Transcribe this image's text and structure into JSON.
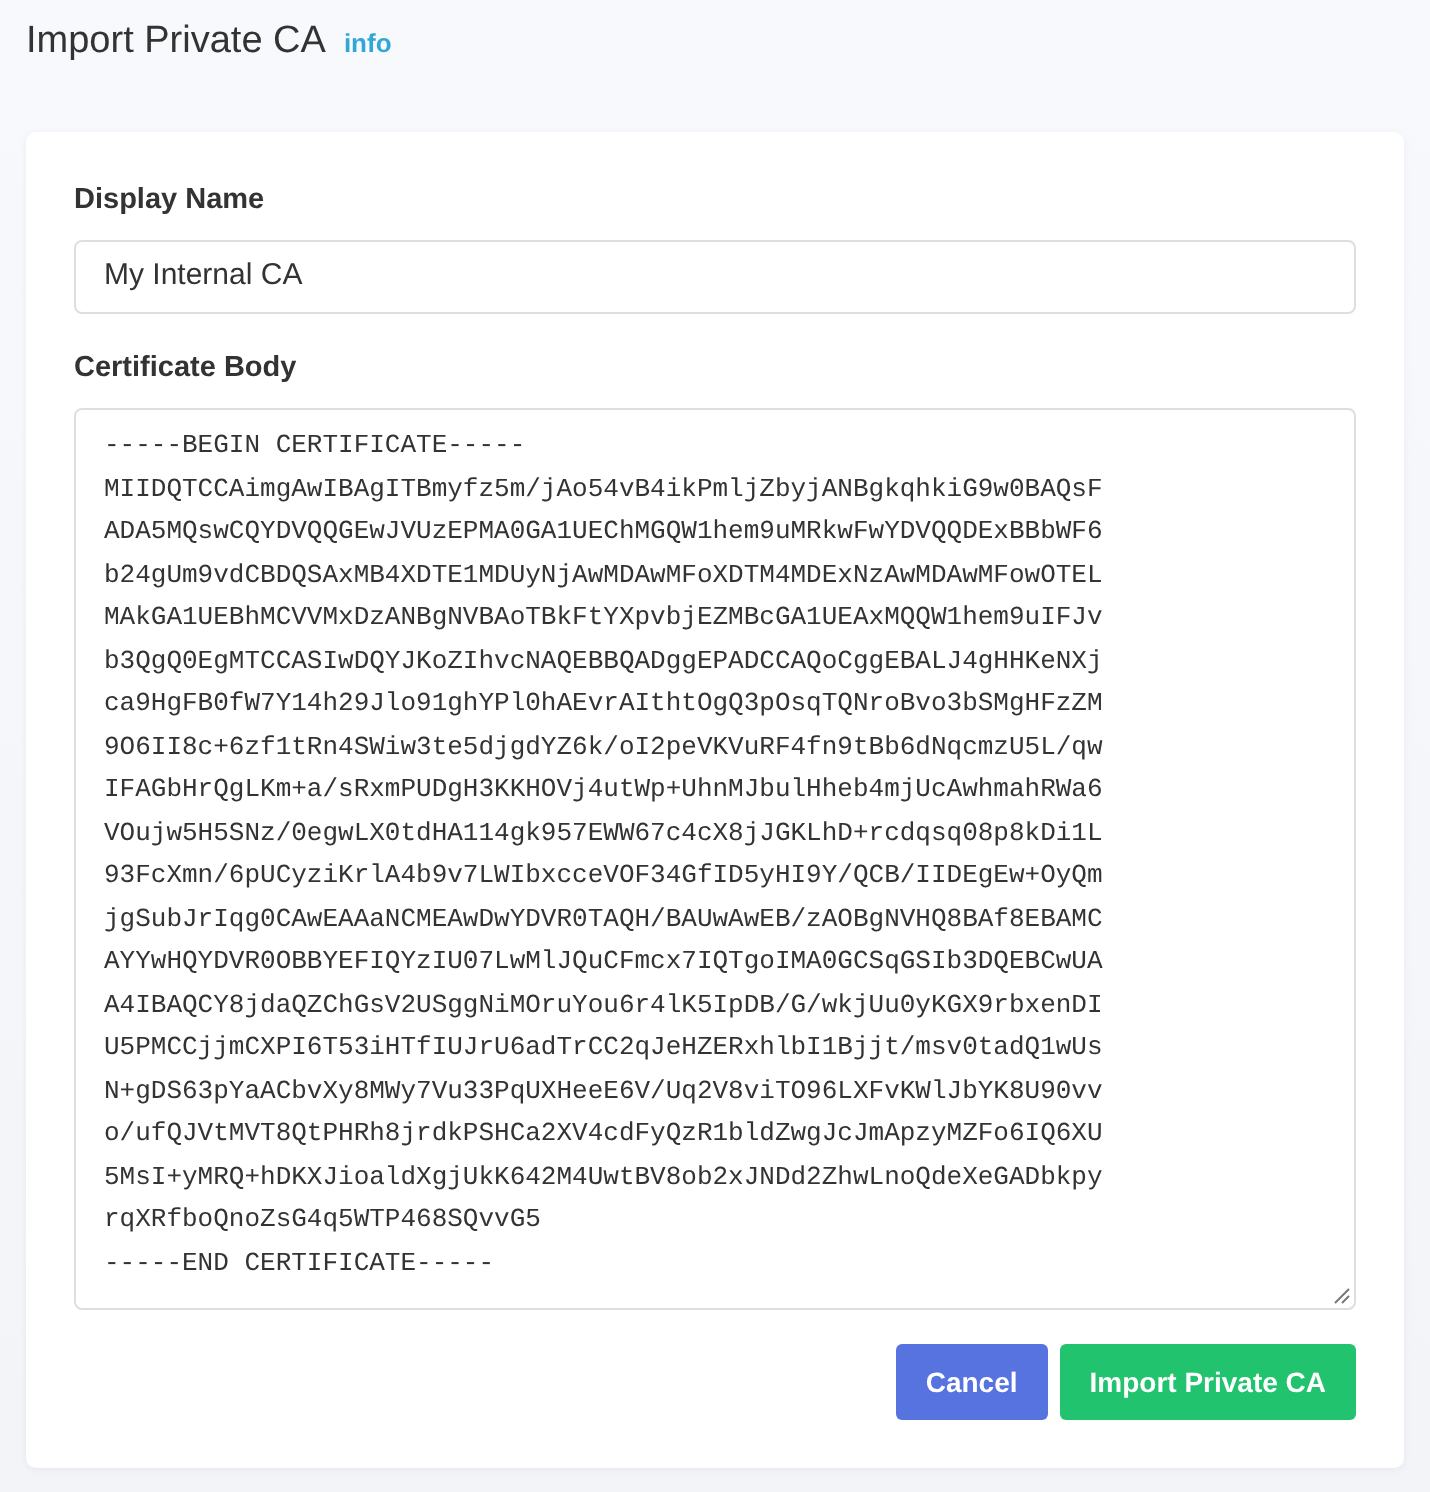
{
  "page": {
    "title": "Import Private CA",
    "info_link": "info"
  },
  "form": {
    "fields": [
      {
        "kind": "input",
        "label": "Display Name",
        "value": "My Internal CA"
      },
      {
        "kind": "textarea",
        "label": "Certificate Body",
        "lines": [
          "-----BEGIN CERTIFICATE-----",
          "MIIDQTCCAimgAwIBAgITBmyfz5m/jAo54vB4ikPmljZbyjANBgkqhkiG9w0BAQsF",
          "ADA5MQswCQYDVQQGEwJVUzEPMA0GA1UEChMGQW1hem9uMRkwFwYDVQQDExBBbWF6",
          "b24gUm9vdCBDQSAxMB4XDTE1MDUyNjAwMDAwMFoXDTM4MDExNzAwMDAwMFowOTEL",
          "MAkGA1UEBhMCVVMxDzANBgNVBAoTBkFtYXpvbjEZMBcGA1UEAxMQQW1hem9uIFJv",
          "b3QgQ0EgMTCCASIwDQYJKoZIhvcNAQEBBQADggEPADCCAQoCggEBALJ4gHHKeNXj",
          "ca9HgFB0fW7Y14h29Jlo91ghYPl0hAEvrAIthtOgQ3pOsqTQNroBvo3bSMgHFzZM",
          "9O6II8c+6zf1tRn4SWiw3te5djgdYZ6k/oI2peVKVuRF4fn9tBb6dNqcmzU5L/qw",
          "IFAGbHrQgLKm+a/sRxmPUDgH3KKHOVj4utWp+UhnMJbulHheb4mjUcAwhmahRWa6",
          "VOujw5H5SNz/0egwLX0tdHA114gk957EWW67c4cX8jJGKLhD+rcdqsq08p8kDi1L",
          "93FcXmn/6pUCyziKrlA4b9v7LWIbxcceVOF34GfID5yHI9Y/QCB/IIDEgEw+OyQm",
          "jgSubJrIqg0CAwEAAaNCMEAwDwYDVR0TAQH/BAUwAwEB/zAOBgNVHQ8BAf8EBAMC",
          "AYYwHQYDVR0OBBYEFIQYzIU07LwMlJQuCFmcx7IQTgoIMA0GCSqGSIb3DQEBCwUA",
          "A4IBAQCY8jdaQZChGsV2USggNiMOruYou6r4lK5IpDB/G/wkjUu0yKGX9rbxenDI",
          "U5PMCCjjmCXPI6T53iHTfIUJrU6adTrCC2qJeHZERxhlbI1Bjjt/msv0tadQ1wUs",
          "N+gDS63pYaACbvXy8MWy7Vu33PqUXHeeE6V/Uq2V8viTO96LXFvKWlJbYK8U90vv",
          "o/ufQJVtMVT8QtPHRh8jrdkPSHCa2XV4cdFyQzR1bldZwgJcJmApzyMZFo6IQ6XU",
          "5MsI+yMRQ+hDKXJioaldXgjUkK642M4UwtBV8ob2xJNDd2ZhwLnoQdeXeGADbkpy",
          "rqXRfboQnoZsG4q5WTP468SQvvG5",
          "-----END CERTIFICATE-----"
        ]
      }
    ]
  },
  "buttons": [
    {
      "kind": "secondary",
      "label": "Cancel"
    },
    {
      "kind": "primary",
      "label": "Import Private CA"
    }
  ]
}
